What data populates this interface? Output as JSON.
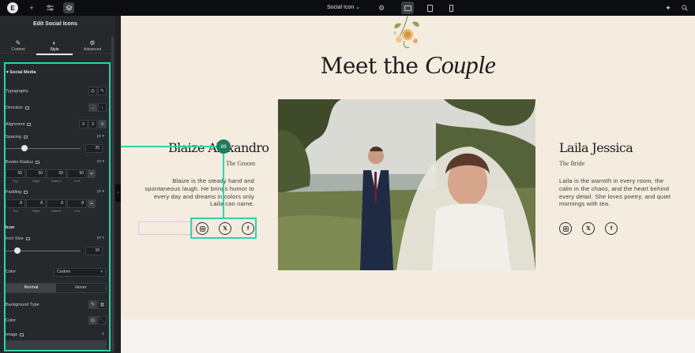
{
  "topbar": {
    "page_name": "Social Icon"
  },
  "panel": {
    "title": "Edit Social Icons",
    "tabs": [
      {
        "label": "Content",
        "icon": "pencil-icon"
      },
      {
        "label": "Style",
        "icon": "contrast-icon"
      },
      {
        "label": "Advanced",
        "icon": "gear-icon"
      }
    ],
    "section": "Social Media",
    "typography_label": "Typography",
    "direction_label": "Direction",
    "alignment_label": "Alignment",
    "spacing_label": "Spacing",
    "spacing_unit": "px",
    "spacing_value": "25",
    "border_radius_label": "Border Radius",
    "border_radius_unit": "px",
    "border_radius_values": [
      "50",
      "50",
      "50",
      "50"
    ],
    "padding_label": "Padding",
    "padding_unit": "px",
    "padding_values": [
      "8",
      "8",
      "8",
      "8"
    ],
    "dim_labels": [
      "Top",
      "Right",
      "Bottom",
      "Left"
    ],
    "icon_section": "Icon",
    "icon_size_label": "Icon Size",
    "icon_size_unit": "px",
    "icon_size_value": "16",
    "color_label": "Color",
    "color_value": "Custom",
    "state_tabs": [
      "Normal",
      "Hover"
    ],
    "background_type_label": "Background Type",
    "color2_label": "Color",
    "image_label": "Image"
  },
  "canvas": {
    "heading_part1": "Meet the ",
    "heading_part2": "Couple",
    "groom": {
      "name": "Blaize Alexandro",
      "role": "The Groom",
      "bio": "Blaize is the steady hand and spontaneous laugh. He brings humor to every day and dreams in colors only Laila can name."
    },
    "bride": {
      "name": "Laila Jessica",
      "role": "The Bride",
      "bio": "Laila is the warmth in every room, the calm in the chaos, and the heart behind every detail. She loves poetry, and quiet mornings with tea."
    },
    "social_icons": [
      "instagram-icon",
      "x-icon",
      "facebook-icon"
    ],
    "badge_text": "89"
  },
  "colors": {
    "highlight": "#2bd4b1",
    "canvas_bg": "#f3ecdf",
    "panel_bg": "#26292c"
  }
}
